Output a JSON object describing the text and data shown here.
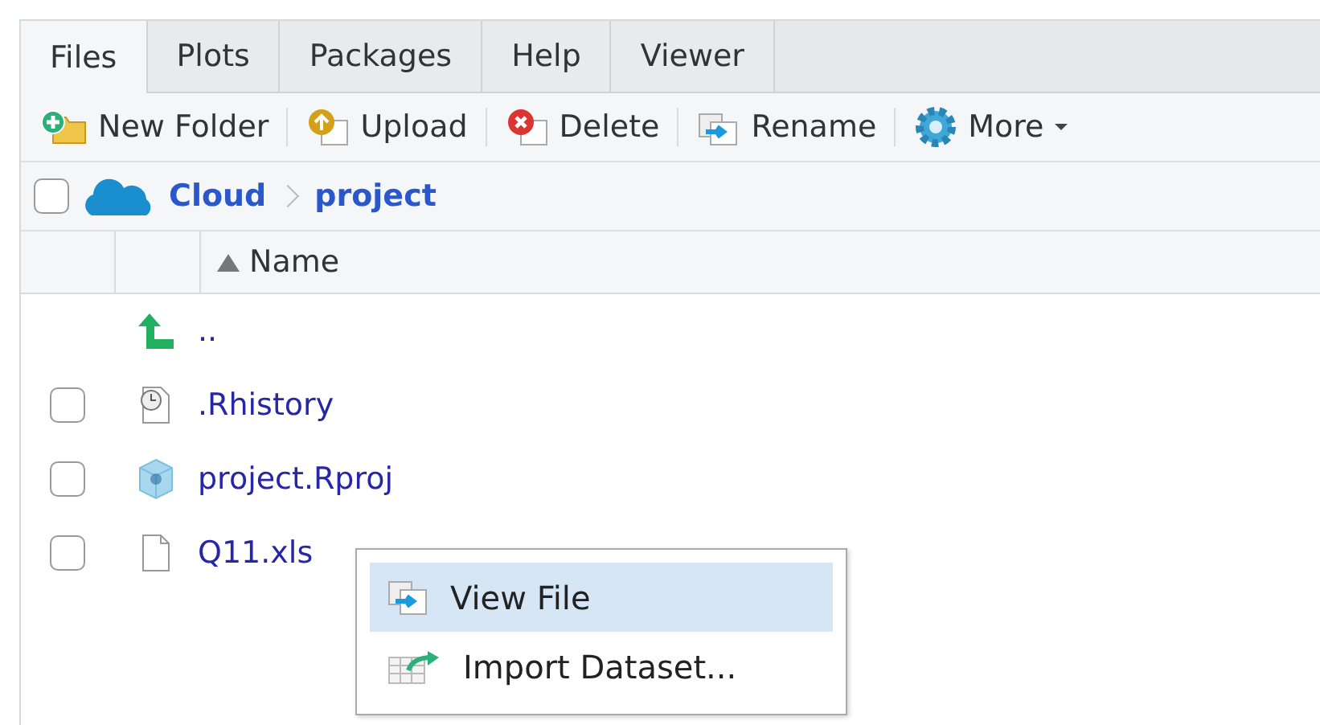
{
  "tabs": [
    {
      "label": "Files",
      "selected": true
    },
    {
      "label": "Plots",
      "selected": false
    },
    {
      "label": "Packages",
      "selected": false
    },
    {
      "label": "Help",
      "selected": false
    },
    {
      "label": "Viewer",
      "selected": false
    }
  ],
  "toolbar": [
    {
      "label": "New Folder",
      "kind": "new_folder"
    },
    {
      "label": "Upload",
      "kind": "upload"
    },
    {
      "label": "Delete",
      "kind": "delete"
    },
    {
      "label": "Rename",
      "kind": "rename"
    },
    {
      "label": "More",
      "kind": "more"
    }
  ],
  "breadcrumb": {
    "checked": false,
    "items": [
      "Cloud",
      "project"
    ]
  },
  "table": {
    "columns": [
      {
        "label": "Name",
        "sort_ascending": true
      }
    ],
    "rows": [
      {
        "name": "..",
        "kind": "parent"
      },
      {
        "name": ".Rhistory",
        "kind": "history",
        "checked": false
      },
      {
        "name": "project.Rproj",
        "kind": "rproj",
        "checked": false
      },
      {
        "name": "Q11.xls",
        "kind": "file",
        "checked": false
      }
    ]
  },
  "context_menu": [
    {
      "label": "View File",
      "kind": "view",
      "selected": true
    },
    {
      "label": "Import Dataset...",
      "kind": "import",
      "selected": false
    }
  ]
}
